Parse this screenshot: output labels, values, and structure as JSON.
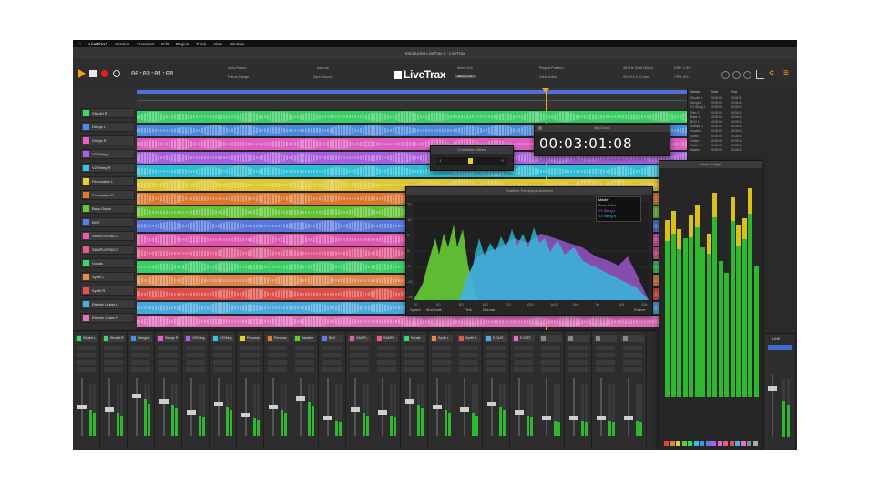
{
  "menubar": {
    "items": [
      "LiveTrax2",
      "Session",
      "Transport",
      "Edit",
      "Region",
      "Track",
      "View",
      "Window"
    ]
  },
  "window_title": "Introducing LiveTrax 2 - LiveTrax",
  "toolbar": {
    "timecode": "00:03:01:08",
    "auto_return": "Auto-Return",
    "follow_range": "Follow Range",
    "internal": "Internal",
    "sync_source": "Sync Source",
    "logo": "LiveTrax",
    "mono_out": "Mono Out",
    "mono_out_value": "IMAC OUT",
    "playlist_position": "Playlist Position",
    "clear_active": "Clear Active",
    "rate": "48 kHz 32bit (WAV)",
    "time": "00:03:1:2 21 min",
    "dsp": "DSP: 1.3%",
    "cpu": "CPU: 8%"
  },
  "tracks": [
    {
      "name": "Strudel R",
      "color": "#3cd86a"
    },
    {
      "name": "Drings L",
      "color": "#4b8ee8"
    },
    {
      "name": "Drings R",
      "color": "#e660c8"
    },
    {
      "name": "V2 String L",
      "color": "#b060e8"
    },
    {
      "name": "V2 String R",
      "color": "#2cc6e0"
    },
    {
      "name": "Percussion L",
      "color": "#e8d030"
    },
    {
      "name": "Percussion R",
      "color": "#e87a30"
    },
    {
      "name": "Bass Guitar",
      "color": "#66cc33"
    },
    {
      "name": "BGV",
      "color": "#5a7ce8"
    },
    {
      "name": "SAMPLE PAD L",
      "color": "#e858b8"
    },
    {
      "name": "SAMPLE PAD R",
      "color": "#e85890"
    },
    {
      "name": "Vocals",
      "color": "#39d86a"
    },
    {
      "name": "Synth L",
      "color": "#e8884a"
    },
    {
      "name": "Synth R",
      "color": "#e8504a"
    },
    {
      "name": "Electric Guitar L",
      "color": "#4ab0e8"
    },
    {
      "name": "Electric Guitar R",
      "color": "#e870c0"
    }
  ],
  "regions_panel": {
    "headers": [
      "Name",
      "Start",
      "End"
    ],
    "rows": [
      [
        "Strudel 1",
        "00:00:00",
        "00:03:01"
      ],
      [
        "Drings 1",
        "00:00:00",
        "00:03:01"
      ],
      [
        "V2 String 1",
        "00:00:00",
        "00:03:01"
      ],
      [
        "Perc 1",
        "00:00:00",
        "00:03:01"
      ],
      [
        "Bass 1",
        "00:00:00",
        "00:03:01"
      ],
      [
        "BGV 1",
        "00:00:00",
        "00:03:01"
      ],
      [
        "Sample 1",
        "00:00:00",
        "00:03:01"
      ],
      [
        "Vocals 1",
        "00:00:00",
        "00:03:01"
      ],
      [
        "Synth 1",
        "00:00:00",
        "00:03:01"
      ],
      [
        "Guitar 1",
        "00:00:00",
        "00:03:01"
      ],
      [
        "Guitar 2",
        "00:00:00",
        "00:03:01"
      ],
      [
        "Master",
        "00:00:00",
        "00:03:01"
      ]
    ]
  },
  "big_clock": {
    "title": "Big Clock",
    "time": "00:03:01:08"
  },
  "correlation_meter": {
    "title": "Correlation Meter",
    "left": "-1",
    "right": "+1"
  },
  "analyzer": {
    "title": "Realtime Perceptual Analyzer",
    "legend": [
      {
        "name": "Master",
        "color": "#ffffff"
      },
      {
        "name": "Bass Guitar",
        "color": "#66cc33"
      },
      {
        "name": "V2 String L",
        "color": "#b060e8"
      },
      {
        "name": "V2 String R",
        "color": "#2cc6e0"
      }
    ],
    "x_ticks": [
      "20",
      "40",
      "80",
      "160",
      "315",
      "630",
      "1k25",
      "2k5",
      "5k",
      "10k",
      "20k"
    ],
    "y_ticks": [
      "18",
      "12",
      "6",
      "0",
      "-6",
      "-12",
      "-18"
    ],
    "footer": [
      "Speed",
      "Moderate",
      "Pink",
      "Normal",
      "Freeze"
    ]
  },
  "meter_bridge": {
    "title": "Meter Bridge"
  },
  "mixer_strips": [
    {
      "name": "Strudel L",
      "color": "#3cd86a",
      "level": 0.5
    },
    {
      "name": "Strudel R",
      "color": "#3cd86a",
      "level": 0.45
    },
    {
      "name": "Strings L",
      "color": "#4b8ee8",
      "level": 0.7
    },
    {
      "name": "Strings R",
      "color": "#e660c8",
      "level": 0.6
    },
    {
      "name": "V2String",
      "color": "#b060e8",
      "level": 0.4
    },
    {
      "name": "V2String",
      "color": "#2cc6e0",
      "level": 0.55
    },
    {
      "name": "Percussi.",
      "color": "#e8d030",
      "level": 0.35
    },
    {
      "name": "Percussi.",
      "color": "#e87a30",
      "level": 0.5
    },
    {
      "name": "Bassline",
      "color": "#66cc33",
      "level": 0.65
    },
    {
      "name": "BGV",
      "color": "#5a7ce8",
      "level": 0.3
    },
    {
      "name": "SAMPL.",
      "color": "#e858b8",
      "level": 0.45
    },
    {
      "name": "SAMPL.",
      "color": "#e85890",
      "level": 0.4
    },
    {
      "name": "Vocals",
      "color": "#39d86a",
      "level": 0.6
    },
    {
      "name": "Synth L",
      "color": "#e8884a",
      "level": 0.5
    },
    {
      "name": "Synth R",
      "color": "#e8504a",
      "level": 0.45
    },
    {
      "name": "E.GUIT.",
      "color": "#4ab0e8",
      "level": 0.55
    },
    {
      "name": "E.GUIT.",
      "color": "#e870c0",
      "level": 0.4
    },
    {
      "name": "",
      "color": "#888888",
      "level": 0.3
    },
    {
      "name": "",
      "color": "#888888",
      "level": 0.3
    },
    {
      "name": "",
      "color": "#888888",
      "level": 0.3
    },
    {
      "name": "",
      "color": "#888888",
      "level": 0.3
    }
  ],
  "master": {
    "label": "LINE"
  }
}
